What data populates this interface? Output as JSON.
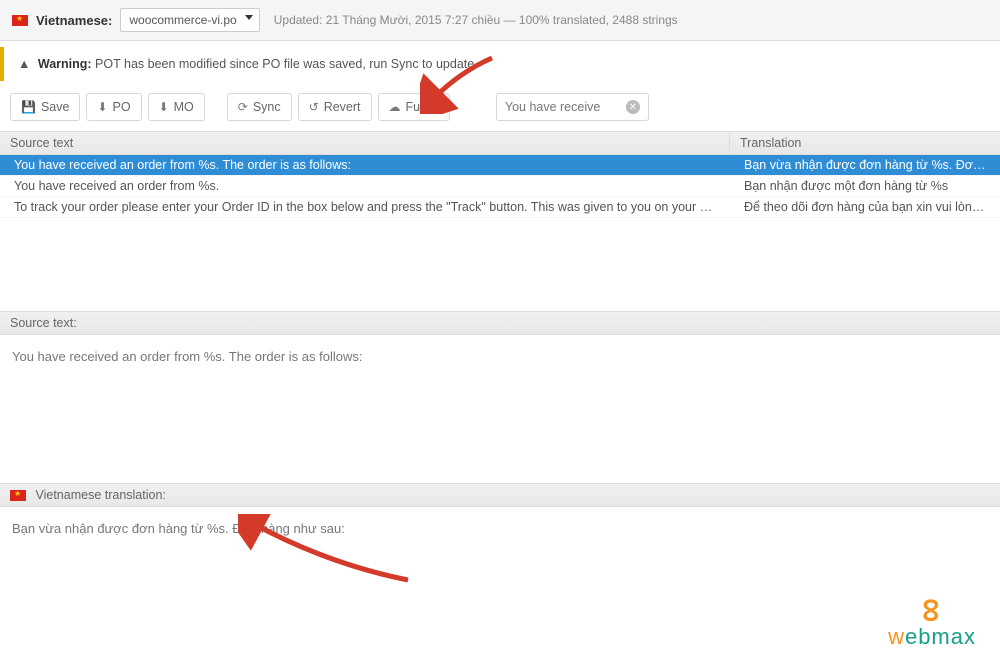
{
  "topbar": {
    "language_label": "Vietnamese:",
    "file_name": "woocommerce-vi.po",
    "updated_text": "Updated: 21 Tháng Mười, 2015 7:27 chiều — 100% translated, 2488 strings"
  },
  "warning": {
    "label": "Warning:",
    "text": "POT has been modified since PO file was saved, run Sync to update"
  },
  "toolbar": {
    "save": "Save",
    "po": "PO",
    "mo": "MO",
    "sync": "Sync",
    "revert": "Revert",
    "fuzzy": "Fuzzy",
    "filter_value": "You have receive"
  },
  "table": {
    "header_source": "Source text",
    "header_translation": "Translation",
    "rows": [
      {
        "source": "You have received an order from %s. The order is as follows:",
        "translation": "Bạn vừa nhận được đơn hàng từ %s. Đơn hàng như sau:",
        "selected": true
      },
      {
        "source": "You have received an order from %s.",
        "translation": "Bạn nhận được một đơn hàng từ %s",
        "selected": false
      },
      {
        "source": "To track your order please enter your Order ID in the box below and press the \"Track\" button. This was given to you on your recei...",
        "translation": "Để theo dõi đơn hàng của bạn xin vui lòng nhập ID đơn hàng của l",
        "selected": false
      }
    ]
  },
  "source_panel": {
    "header": "Source text:",
    "body": "You have received an order from %s. The order is as follows:"
  },
  "translation_panel": {
    "header": "Vietnamese translation:",
    "body": "Bạn vừa nhận được đơn hàng từ %s. Đơn hàng như sau:"
  },
  "watermark": {
    "brand_w": "w",
    "brand_rest": "ebmax"
  }
}
